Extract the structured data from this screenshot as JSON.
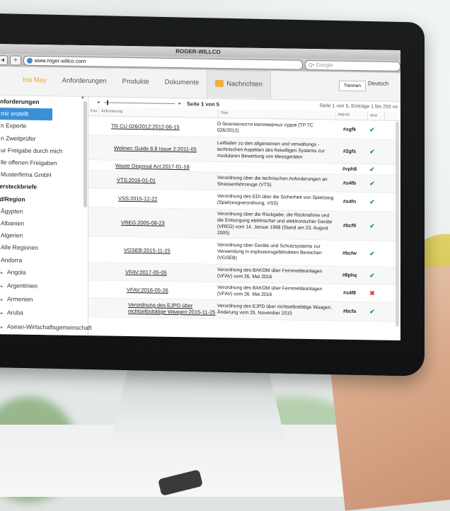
{
  "browser": {
    "window_title": "ROGER-WILLCO",
    "url": "www.roger-willco.com",
    "search_placeholder": "Q• Google",
    "add_tab": "+"
  },
  "header": {
    "user": "Ina May",
    "nav": [
      "Anforderungen",
      "Produkte",
      "Dokumente",
      "Nachrichten"
    ],
    "logout_label": "Trennen",
    "language": "Deutsch"
  },
  "sidebar": {
    "items": [
      {
        "label": "Anforderungen",
        "style": "hd"
      },
      {
        "label": "n mir erstellt",
        "style": "sel"
      },
      {
        "label": "n Experte",
        "style": ""
      },
      {
        "label": "n Zweitprüfer",
        "style": ""
      },
      {
        "label": "ur Freigabe durch mich",
        "style": ""
      },
      {
        "label": "lle offenen Freigaben",
        "style": ""
      },
      {
        "label": "Musterfirma GmbH",
        "style": ""
      },
      {
        "label": "dersteckbriefe",
        "style": "hd"
      },
      {
        "label": "nd/Region",
        "style": "hd"
      },
      {
        "label": "Ägypten",
        "style": "c1"
      },
      {
        "label": "Albanien",
        "style": "c1"
      },
      {
        "label": "Algerien",
        "style": "c1"
      },
      {
        "label": "Alle Regionen",
        "style": "c1"
      },
      {
        "label": "Andorra",
        "style": "c1"
      },
      {
        "label": "Angola",
        "style": "tri"
      },
      {
        "label": "Argentinien",
        "style": "tri"
      },
      {
        "label": "Armenien",
        "style": "tri"
      },
      {
        "label": "Aruba",
        "style": "tri"
      },
      {
        "label": "Asean-Wirtschaftsgemeinschaft",
        "style": "tri"
      }
    ]
  },
  "pager": {
    "prev": "◂",
    "next": "▸",
    "seite_label": "Seite",
    "page": "1",
    "von": "von",
    "pages": "5",
    "count_text": "Seite 1 von 5, Einträge 1 bis 250 vo"
  },
  "table": {
    "columns": [
      "Fav.",
      "Anforderung",
      "Titel",
      "RW-ID",
      "atus"
    ],
    "rows": [
      {
        "anf": "TR CU 026/2012:2012-06-15",
        "titel": "О безопасности маломерных судов (TP TC 026/2012)",
        "rwid": "#xgfk",
        "status": "ok",
        "indent": 18,
        "h": 26
      },
      {
        "anf": "Welmec Guide 8.8 Issue 2:2011-05",
        "titel": "Leitfaden zu den allgemeinen und verwaltungs - technischen Aspekten des freiwilligen Systems zur modularen Bewertung von Messgeräten",
        "rwid": "#2gfs",
        "status": "ok",
        "indent": 22,
        "h": 34
      },
      {
        "anf": "Waste Disposal Act:2017-01-18",
        "titel": "",
        "rwid": "#vph8",
        "status": "ok",
        "indent": 24,
        "h": 14
      },
      {
        "anf": "VTS:2016-01-01",
        "titel": "Verordnung über die technischen Anforderungen an Strassenfahrzeuge (VTS)",
        "rwid": "#s4fb",
        "status": "ok",
        "indent": 26,
        "h": 24
      },
      {
        "anf": "VSS:2015-12-22",
        "titel": "Verordnung des EDI über die Sicherheit von Spielzeug (Spielzeugverordnung, VSS)",
        "rwid": "#s4fn",
        "status": "ok",
        "indent": 28,
        "h": 26
      },
      {
        "anf": "VREG:2005-08-23",
        "titel": "Verordnung über die Rückgabe, die Rücknahme und die Entsorgung elektrischer und elektronischer Geräte (VREG) vom 14. Januar 1998 (Stand am 23. August 2005)",
        "rwid": "#bcf9",
        "status": "ok",
        "indent": 32,
        "h": 40
      },
      {
        "anf": "VGSEB:2015-11-25",
        "titel": "Verordnung über Geräte und Schutzsysteme zur Verwendung in explosionsgefährdeten Bereichen (VGSEB)",
        "rwid": "#bcfw",
        "status": "ok",
        "indent": 36,
        "h": 36
      },
      {
        "anf": "VFAV:2017-05-05",
        "titel": "Verordnung des BAKOM über Fernmeldeanlagen (VFAV) vom 26. Mai 2016",
        "rwid": "#8phq",
        "status": "ok",
        "indent": 38,
        "h": 24
      },
      {
        "anf": "VFAV:2016-05-26",
        "titel": "Verordnung des BAKOM über Fernmeldeanlagen (VFAV) vom 26. Mai 2016",
        "rwid": "#s4f8",
        "status": "no",
        "indent": 40,
        "h": 24
      },
      {
        "anf": "Verordnung des EJPD über nichtselbsttätige Waagen:2015-11-25",
        "titel": "Verordnung des EJPD über nichtselbsttätige Waagen, Änderung vom 25. November 2015",
        "rwid": "#bcfa",
        "status": "ok",
        "indent": 42,
        "h": 26
      }
    ]
  },
  "icons": {
    "ok": "✔",
    "no": "✖"
  },
  "colors": {
    "accent": "#3b8fd6",
    "user": "#f0a030",
    "ok": "#2d9a4a",
    "no": "#d83a3a"
  }
}
